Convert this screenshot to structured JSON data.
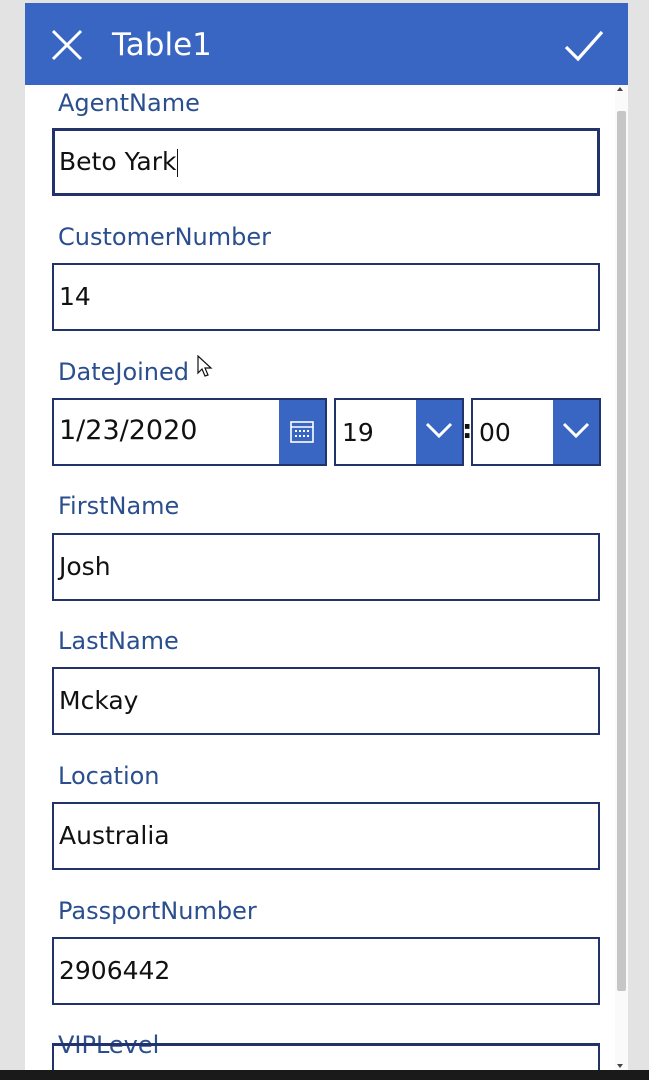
{
  "header": {
    "title": "Table1",
    "close_icon": "close-icon",
    "submit_icon": "check-icon"
  },
  "colors": {
    "accent": "#3a66c3",
    "label": "#2b4f8e",
    "border": "#22336b"
  },
  "fields": {
    "agent_name": {
      "label": "AgentName",
      "value": "Beto Yark"
    },
    "customer_number": {
      "label": "CustomerNumber",
      "value": "14"
    },
    "date_joined": {
      "label": "DateJoined",
      "date": "1/23/2020",
      "hour": "19",
      "minute": "00",
      "separator": ":"
    },
    "first_name": {
      "label": "FirstName",
      "value": "Josh"
    },
    "last_name": {
      "label": "LastName",
      "value": "Mckay"
    },
    "location": {
      "label": "Location",
      "value": "Australia"
    },
    "passport_number": {
      "label": "PassportNumber",
      "value": "2906442"
    },
    "vip_level": {
      "label": "VIPLevel"
    }
  }
}
